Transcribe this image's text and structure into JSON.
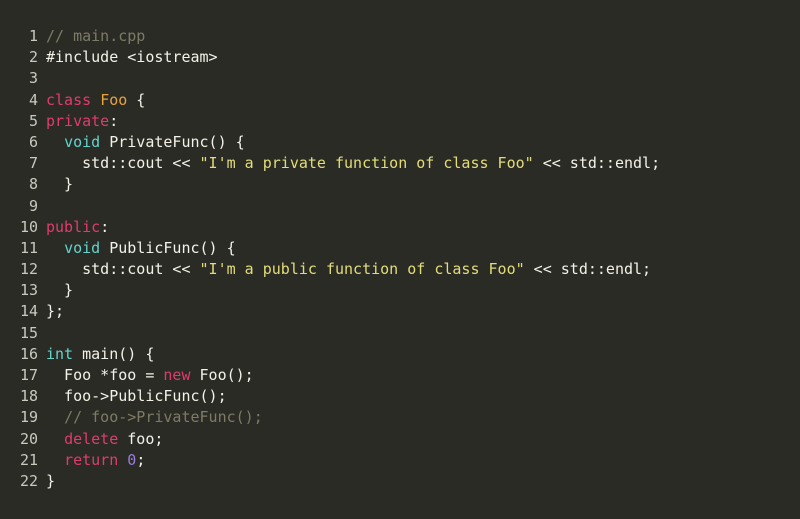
{
  "editor": {
    "filename": "main.cpp",
    "language": "cpp",
    "background_color": "#2B2B26",
    "gutter_color": "#C9C9BE",
    "total_lines": 22
  },
  "theme": {
    "plain": "#F2F2E8",
    "comment": "#7C7C66",
    "keyword": "#E13B6E",
    "type": "#63D3CE",
    "class_name": "#E8A33D",
    "function": "#E8A33D",
    "string": "#E3DD78",
    "number": "#9B7BE0"
  },
  "code": {
    "lines": [
      {
        "number": "1",
        "text": "// main.cpp",
        "tokens": [
          {
            "t": "// main.cpp",
            "c": "comment"
          }
        ]
      },
      {
        "number": "2",
        "text": "#include <iostream>",
        "tokens": [
          {
            "t": "#include <iostream>",
            "c": "plain"
          }
        ]
      },
      {
        "number": "3",
        "text": "",
        "tokens": []
      },
      {
        "number": "4",
        "text": "class Foo {",
        "tokens": [
          {
            "t": "class",
            "c": "keyword"
          },
          {
            "t": " ",
            "c": "plain"
          },
          {
            "t": "Foo",
            "c": "class_name"
          },
          {
            "t": " {",
            "c": "plain"
          }
        ]
      },
      {
        "number": "5",
        "text": "private:",
        "tokens": [
          {
            "t": "private",
            "c": "keyword"
          },
          {
            "t": ":",
            "c": "plain"
          }
        ]
      },
      {
        "number": "6",
        "text": "  void PrivateFunc() {",
        "tokens": [
          {
            "t": "  ",
            "c": "plain"
          },
          {
            "t": "void",
            "c": "type"
          },
          {
            "t": " PrivateFunc() {",
            "c": "plain"
          }
        ]
      },
      {
        "number": "7",
        "text": "    std::cout << \"I'm a private function of class Foo\" << std::endl;",
        "tokens": [
          {
            "t": "    std::cout << ",
            "c": "plain"
          },
          {
            "t": "\"I'm a private function of class Foo\"",
            "c": "string"
          },
          {
            "t": " << std::endl;",
            "c": "plain"
          }
        ]
      },
      {
        "number": "8",
        "text": "  }",
        "tokens": [
          {
            "t": "  }",
            "c": "plain"
          }
        ]
      },
      {
        "number": "9",
        "text": "",
        "tokens": []
      },
      {
        "number": "10",
        "text": "public:",
        "tokens": [
          {
            "t": "public",
            "c": "keyword"
          },
          {
            "t": ":",
            "c": "plain"
          }
        ]
      },
      {
        "number": "11",
        "text": "  void PublicFunc() {",
        "tokens": [
          {
            "t": "  ",
            "c": "plain"
          },
          {
            "t": "void",
            "c": "type"
          },
          {
            "t": " PublicFunc() {",
            "c": "plain"
          }
        ]
      },
      {
        "number": "12",
        "text": "    std::cout << \"I'm a public function of class Foo\" << std::endl;",
        "tokens": [
          {
            "t": "    std::cout << ",
            "c": "plain"
          },
          {
            "t": "\"I'm a public function of class Foo\"",
            "c": "string"
          },
          {
            "t": " << std::endl;",
            "c": "plain"
          }
        ]
      },
      {
        "number": "13",
        "text": "  }",
        "tokens": [
          {
            "t": "  }",
            "c": "plain"
          }
        ]
      },
      {
        "number": "14",
        "text": "};",
        "tokens": [
          {
            "t": "};",
            "c": "plain"
          }
        ]
      },
      {
        "number": "15",
        "text": "",
        "tokens": []
      },
      {
        "number": "16",
        "text": "int main() {",
        "tokens": [
          {
            "t": "int",
            "c": "type"
          },
          {
            "t": " ",
            "c": "plain"
          },
          {
            "t": "main",
            "c": "function"
          },
          {
            "t": "() {",
            "c": "plain"
          }
        ]
      },
      {
        "number": "17",
        "text": "  Foo *foo = new Foo();",
        "tokens": [
          {
            "t": "  Foo *foo = ",
            "c": "plain"
          },
          {
            "t": "new",
            "c": "keyword"
          },
          {
            "t": " Foo();",
            "c": "plain"
          }
        ]
      },
      {
        "number": "18",
        "text": "  foo->PublicFunc();",
        "tokens": [
          {
            "t": "  foo->PublicFunc();",
            "c": "plain"
          }
        ]
      },
      {
        "number": "19",
        "text": "  // foo->PrivateFunc();",
        "tokens": [
          {
            "t": "  ",
            "c": "plain"
          },
          {
            "t": "// foo->PrivateFunc();",
            "c": "comment"
          }
        ]
      },
      {
        "number": "20",
        "text": "  delete foo;",
        "tokens": [
          {
            "t": "  ",
            "c": "plain"
          },
          {
            "t": "delete",
            "c": "keyword"
          },
          {
            "t": " foo;",
            "c": "plain"
          }
        ]
      },
      {
        "number": "21",
        "text": "  return 0;",
        "tokens": [
          {
            "t": "  ",
            "c": "plain"
          },
          {
            "t": "return",
            "c": "keyword"
          },
          {
            "t": " ",
            "c": "plain"
          },
          {
            "t": "0",
            "c": "number"
          },
          {
            "t": ";",
            "c": "plain"
          }
        ]
      },
      {
        "number": "22",
        "text": "}",
        "tokens": [
          {
            "t": "}",
            "c": "plain"
          }
        ]
      }
    ]
  }
}
